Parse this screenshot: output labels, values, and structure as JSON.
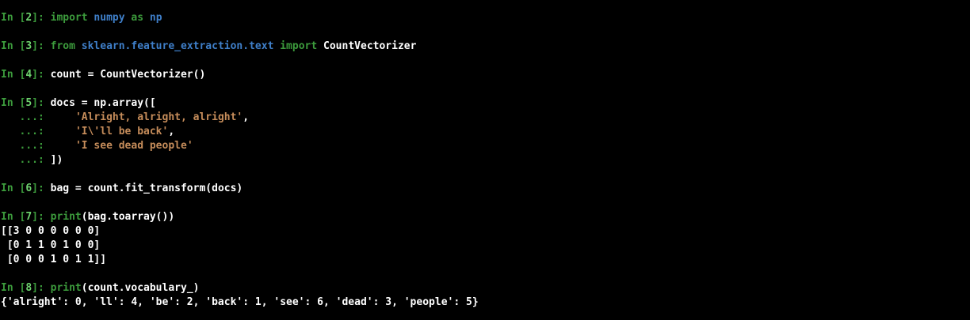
{
  "cells": {
    "c2": {
      "prompt_label": "In [",
      "prompt_num": "2",
      "prompt_end": "]: ",
      "kw1": "import",
      "sp1": " ",
      "mod": "numpy",
      "sp2": " ",
      "kw2": "as",
      "sp3": " ",
      "alias": "np"
    },
    "c3": {
      "prompt_label": "In [",
      "prompt_num": "3",
      "prompt_end": "]: ",
      "kw1": "from",
      "sp1": " ",
      "mod": "sklearn.feature_extraction.text",
      "sp2": " ",
      "kw2": "import",
      "sp3": " ",
      "name": "CountVectorizer"
    },
    "c4": {
      "prompt_label": "In [",
      "prompt_num": "4",
      "prompt_end": "]: ",
      "code": "count = CountVectorizer()"
    },
    "c5": {
      "prompt_label": "In [",
      "prompt_num": "5",
      "prompt_end": "]: ",
      "code": "docs = np.array([",
      "cont_prompt": "   ...:",
      "indent": "     ",
      "str1": "'Alright, alright, alright'",
      "str1_tail": ",",
      "str2": "'I\\'ll be back'",
      "str2_tail": ",",
      "str3": "'I see dead people'",
      "close_pad": " ",
      "close": "])"
    },
    "c6": {
      "prompt_label": "In [",
      "prompt_num": "6",
      "prompt_end": "]: ",
      "code": "bag = count.fit_transform(docs)"
    },
    "c7": {
      "prompt_label": "In [",
      "prompt_num": "7",
      "prompt_end": "]: ",
      "fn": "print",
      "code": "(bag.toarray())",
      "out": [
        "[[3 0 0 0 0 0 0]",
        " [0 1 1 0 1 0 0]",
        " [0 0 0 1 0 1 1]]"
      ]
    },
    "c8": {
      "prompt_label": "In [",
      "prompt_num": "8",
      "prompt_end": "]: ",
      "fn": "print",
      "code": "(count.vocabulary_)",
      "out": "{'alright': 0, 'll': 4, 'be': 2, 'back': 1, 'see': 6, 'dead': 3, 'people': 5}"
    }
  },
  "colors": {
    "background": "#000000",
    "prompt": "#3c9b3c",
    "keyword": "#3c9b3c",
    "module": "#3f7fc9",
    "string": "#c58c5a",
    "text": "#ffffff"
  }
}
